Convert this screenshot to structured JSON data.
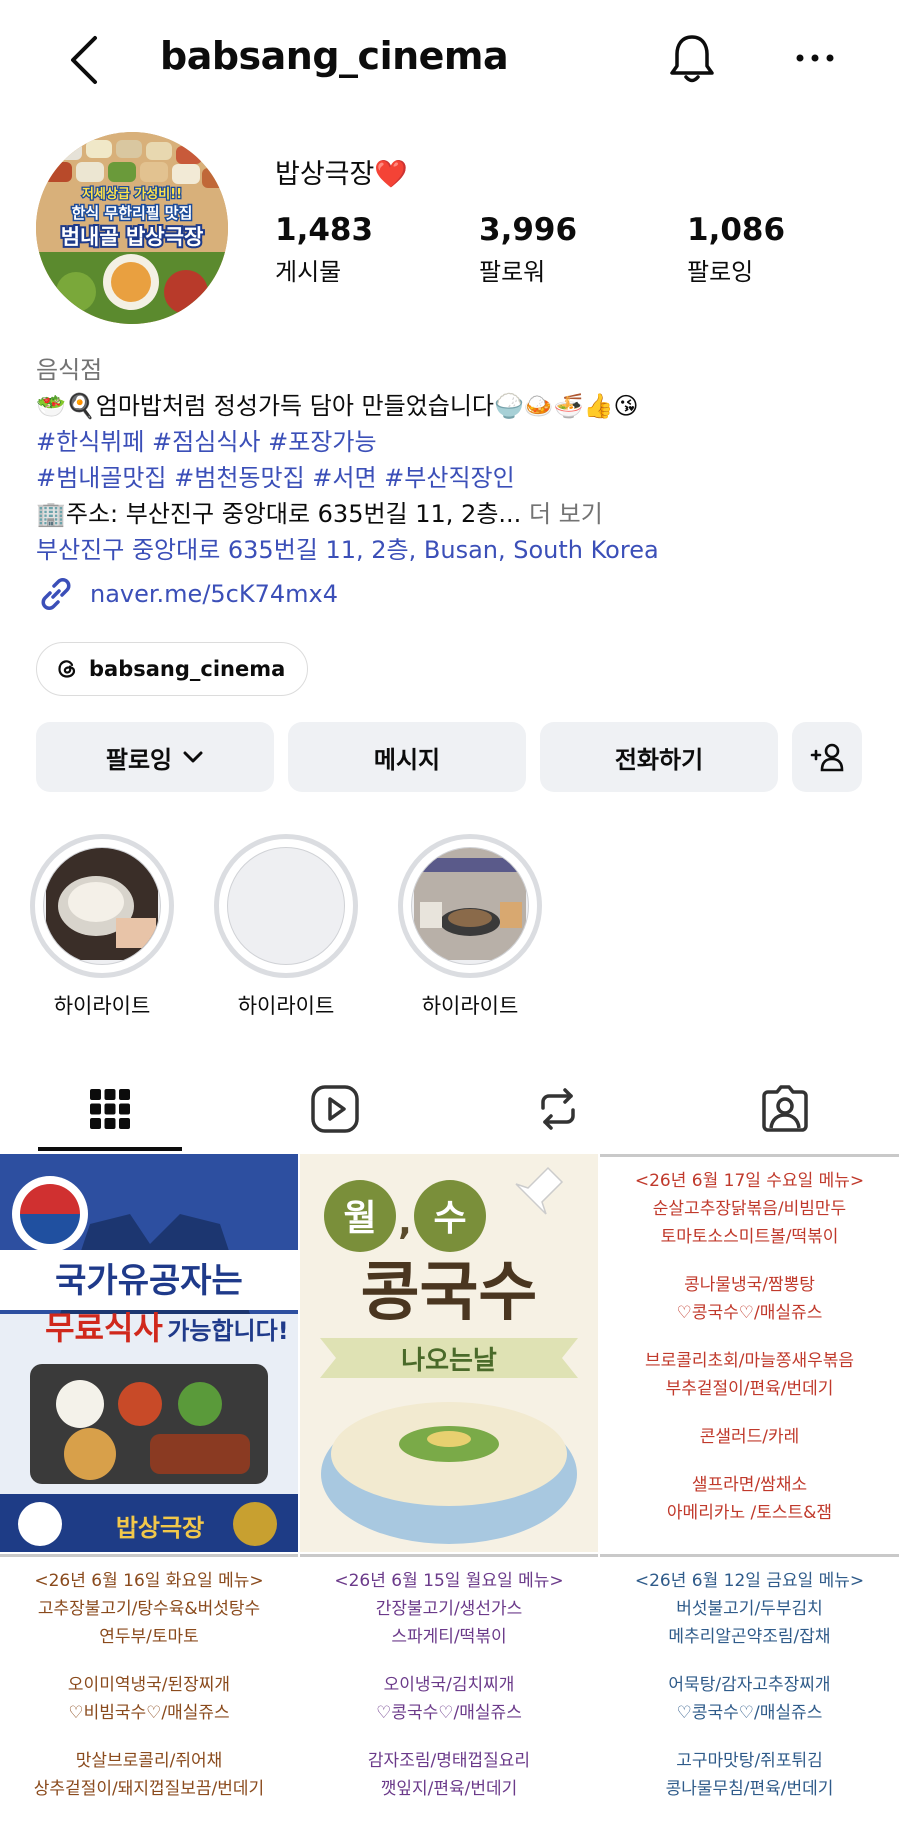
{
  "header": {
    "username": "babsang_cinema"
  },
  "profile": {
    "display_name": "밥상극장❤️",
    "avatar_text": [
      "저세상급 가성비!!",
      "한식 무한리필 맛집",
      "범내골 밥상극장"
    ],
    "stats": [
      {
        "num": "1,483",
        "label": "게시물"
      },
      {
        "num": "3,996",
        "label": "팔로워"
      },
      {
        "num": "1,086",
        "label": "팔로잉"
      }
    ],
    "category": "음식점",
    "bio_line1": "🥗🍳엄마밥처럼 정성가득 담아 만들었습니다🍚🍛🍜👍😘",
    "hashtags1": "#한식뷔페 #점심식사 #포장가능",
    "hashtags2": "#범내골맛집 #범천동맛집 #서면 #부산직장인",
    "address_line": "🏢주소: 부산진구 중앙대로 635번길 11, 2층...",
    "more_label": "더 보기",
    "location": "부산진구 중앙대로 635번길 11, 2층, Busan, South Korea",
    "link": "naver.me/5cK74mx4",
    "threads": "babsang_cinema"
  },
  "buttons": {
    "following": "팔로잉",
    "message": "메시지",
    "call": "전화하기"
  },
  "highlights": [
    "하이라이트",
    "하이라이트",
    "하이라이트"
  ],
  "posts": {
    "p1": {
      "line1": "국가유공자는",
      "line2": "무료식사",
      "line3": "가능합니다!",
      "brand": "밥상극장"
    },
    "p2": {
      "line1": "월",
      "line2": "수",
      "title": "콩국수",
      "ribbon": "나오는날"
    },
    "p3": [
      "<26년 6월 17일 수요일 메뉴>",
      "순살고추장닭볶음/비빔만두",
      "토마토소스미트볼/떡볶이",
      "",
      "콩나물냉국/짬뽕탕",
      "♡콩국수♡/매실쥬스",
      "",
      "브로콜리초회/마늘쫑새우볶음",
      "부추겉절이/편육/번데기",
      "",
      "콘샐러드/카레",
      "",
      "샐프라면/쌈채소",
      "아메리카노 /토스트&잼"
    ],
    "p4": [
      "<26년 6월 16일 화요일 메뉴>",
      "고추장불고기/탕수육&버섯탕수",
      "연두부/토마토",
      "",
      "오이미역냉국/된장찌개",
      "♡비빔국수♡/매실쥬스",
      "",
      "맛살브로콜리/쥐어채",
      "상추겉절이/돼지껍질보끔/번데기"
    ],
    "p5": [
      "<26년 6월 15일 월요일 메뉴>",
      "간장불고기/생선가스",
      "스파게티/떡볶이",
      "",
      "오이냉국/김치찌개",
      "♡콩국수♡/매실쥬스",
      "",
      "감자조림/명태껍질요리",
      "깻잎지/편육/번데기"
    ],
    "p6": [
      "<26년 6월 12일 금요일 메뉴>",
      "버섯불고기/두부김치",
      "메추리알곤약조림/잡채",
      "",
      "어묵탕/감자고추장찌개",
      "♡콩국수♡/매실쥬스",
      "",
      "고구마맛탕/쥐포튀김",
      "콩나물무침/편육/번데기"
    ]
  },
  "colors": {
    "link_blue": "#3b4fb8",
    "button_bg": "#eff1f4",
    "menu_red": "#c0392b",
    "menu_brown": "#8a4a1c",
    "menu_purple": "#6b3a8a",
    "menu_blue": "#2f5b8a"
  },
  "icons": [
    "back-arrow-icon",
    "bell-icon",
    "more-icon",
    "link-icon",
    "threads-icon",
    "chevron-down-icon",
    "add-person-icon",
    "grid-icon",
    "reels-icon",
    "repost-icon",
    "tagged-icon",
    "pin-icon"
  ]
}
